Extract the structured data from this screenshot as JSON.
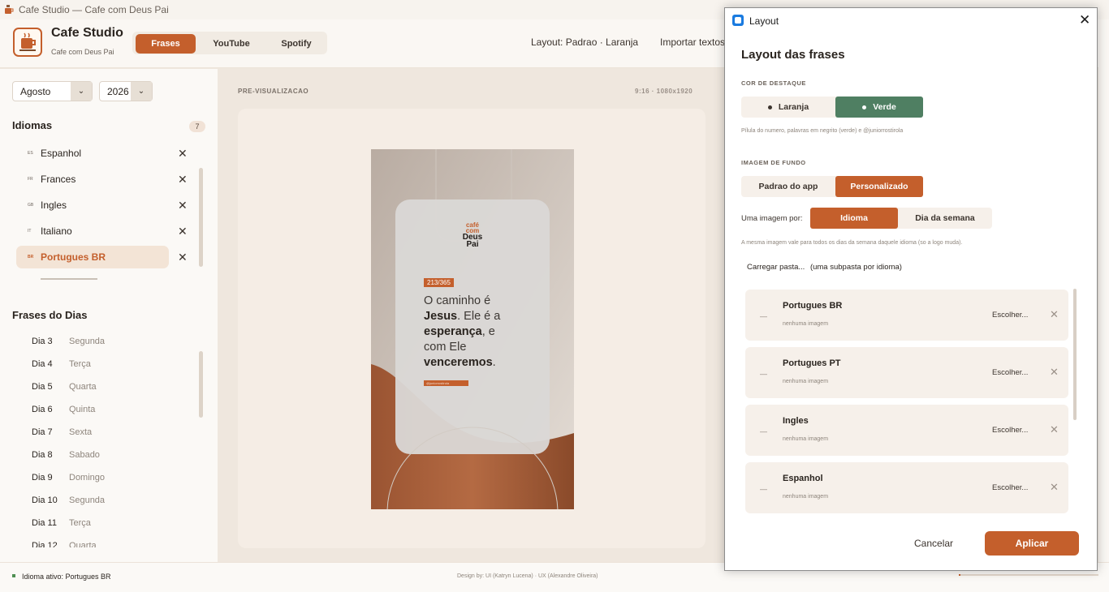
{
  "window": {
    "title": "Cafe Studio — Cafe com Deus Pai"
  },
  "header": {
    "app_name": "Cafe Studio",
    "app_subtitle": "Cafe com Deus Pai",
    "tabs": [
      "Frases",
      "YouTube",
      "Spotify"
    ],
    "layout_info": "Layout: Padrao · Laranja",
    "import_label": "Importar textos"
  },
  "sidebar": {
    "month": "Agosto",
    "year": "2026",
    "languages_title": "Idiomas",
    "languages_count": "7",
    "languages": [
      {
        "code": "ES",
        "name": "Espanhol"
      },
      {
        "code": "FR",
        "name": "Frances"
      },
      {
        "code": "GB",
        "name": "Ingles"
      },
      {
        "code": "IT",
        "name": "Italiano"
      },
      {
        "code": "BR",
        "name": "Portugues BR"
      }
    ],
    "active_language": "Portugues BR",
    "days_title": "Frases do Dias",
    "days": [
      {
        "day": "Dia 3",
        "weekday": "Segunda"
      },
      {
        "day": "Dia 4",
        "weekday": "Terça"
      },
      {
        "day": "Dia 5",
        "weekday": "Quarta"
      },
      {
        "day": "Dia 6",
        "weekday": "Quinta"
      },
      {
        "day": "Dia 7",
        "weekday": "Sexta"
      },
      {
        "day": "Dia 8",
        "weekday": "Sabado"
      },
      {
        "day": "Dia 9",
        "weekday": "Domingo"
      },
      {
        "day": "Dia 10",
        "weekday": "Segunda"
      },
      {
        "day": "Dia 11",
        "weekday": "Terça"
      },
      {
        "day": "Dia 12",
        "weekday": "Quarta"
      }
    ]
  },
  "preview": {
    "label": "PRE-VISUALIZACAO",
    "dimensions": "9:16 · 1080x1920",
    "poster": {
      "logo_lines": [
        "café",
        "com",
        "Deus",
        "Pai"
      ],
      "counter": "213/365",
      "quote_lines": [
        [
          {
            "t": "O caminho é",
            "b": false
          }
        ],
        [
          {
            "t": "Jesus",
            "b": true
          },
          {
            "t": ". Ele é a",
            "b": false
          }
        ],
        [
          {
            "t": "esperança",
            "b": true
          },
          {
            "t": ", e",
            "b": false
          }
        ],
        [
          {
            "t": "com Ele",
            "b": false
          }
        ],
        [
          {
            "t": "venceremos",
            "b": true
          },
          {
            "t": ".",
            "b": false
          }
        ]
      ],
      "handle": "@juniorrostirola"
    }
  },
  "status": {
    "active_language": "Idioma ativo: Portugues BR",
    "credits": "Design by: UI (Katryn Lucena) · UX (Alexandre Oliveira)"
  },
  "dialog": {
    "window_title": "Layout",
    "title": "Layout das frases",
    "accent_caption": "COR DE DESTAQUE",
    "accent_options": [
      "Laranja",
      "Verde"
    ],
    "accent_selected": "Verde",
    "accent_note": "Pílula do numero, palavras em negrito (verde) e @juniorrostirola",
    "bg_caption": "IMAGEM DE FUNDO",
    "bg_options": [
      "Padrao do app",
      "Personalizado"
    ],
    "bg_selected": "Personalizado",
    "per_label": "Uma imagem por:",
    "per_options": [
      "Idioma",
      "Dia da semana"
    ],
    "per_selected": "Idioma",
    "per_note": "A mesma imagem vale para todos os dias da semana daquele idioma (so a logo muda).",
    "load_folder": "Carregar pasta...",
    "load_folder_hint": "(uma subpasta por idioma)",
    "rows": [
      {
        "name": "Portugues BR",
        "status": "nenhuma imagem",
        "choose": "Escolher..."
      },
      {
        "name": "Portugues PT",
        "status": "nenhuma imagem",
        "choose": "Escolher..."
      },
      {
        "name": "Ingles",
        "status": "nenhuma imagem",
        "choose": "Escolher..."
      },
      {
        "name": "Espanhol",
        "status": "nenhuma imagem",
        "choose": "Escolher..."
      }
    ],
    "cancel": "Cancelar",
    "apply": "Aplicar"
  },
  "colors": {
    "accent": "#c45f2c",
    "green": "#4f7f62",
    "bg": "#efe7de"
  },
  "icons": [
    "app-icon",
    "close-icon",
    "chevron-down-icon",
    "remove-icon"
  ]
}
